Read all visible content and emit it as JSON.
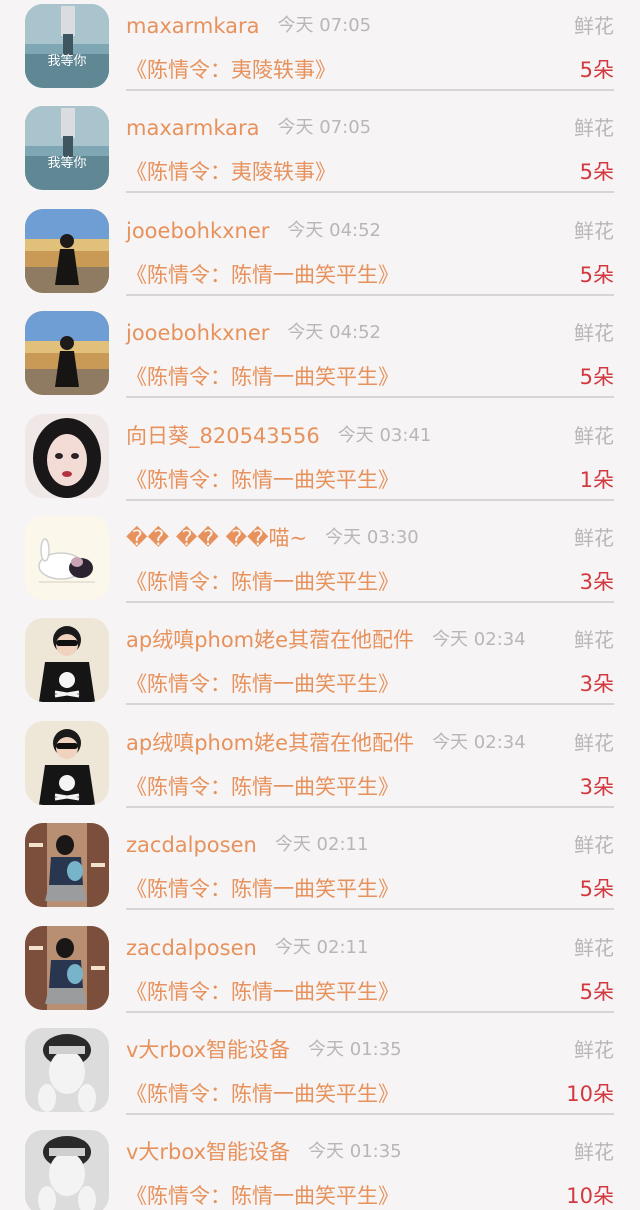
{
  "gift_list": {
    "items": [
      {
        "username": "maxarmkara",
        "time": "今天 07:05",
        "gift": "鲜花",
        "work": "《陈情令：夷陵轶事》",
        "count": "5朵",
        "avatar": "winter-girl-avatar",
        "avatar_text": "我等你"
      },
      {
        "username": "maxarmkara",
        "time": "今天 07:05",
        "gift": "鲜花",
        "work": "《陈情令：夷陵轶事》",
        "count": "5朵",
        "avatar": "winter-girl-avatar",
        "avatar_text": "我等你"
      },
      {
        "username": "jooebohkxner",
        "time": "今天 04:52",
        "gift": "鲜花",
        "work": "《陈情令：陈情一曲笑平生》",
        "count": "5朵",
        "avatar": "field-girl-avatar",
        "avatar_text": ""
      },
      {
        "username": "jooebohkxner",
        "time": "今天 04:52",
        "gift": "鲜花",
        "work": "《陈情令：陈情一曲笑平生》",
        "count": "5朵",
        "avatar": "field-girl-avatar",
        "avatar_text": ""
      },
      {
        "username": "向日葵_820543556",
        "time": "今天 03:41",
        "gift": "鲜花",
        "work": "《陈情令：陈情一曲笑平生》",
        "count": "1朵",
        "avatar": "portrait-girl-avatar",
        "avatar_text": ""
      },
      {
        "username": "�� �� ��喵~",
        "time": "今天 03:30",
        "gift": "鲜花",
        "work": "《陈情令：陈情一曲笑平生》",
        "count": "3朵",
        "avatar": "rabbit-avatar",
        "avatar_text": ""
      },
      {
        "username": "ap绒嗔phom姥e其蓿在他配件",
        "time": "今天 02:34",
        "gift": "鲜花",
        "work": "《陈情令：陈情一曲笑平生》",
        "count": "3朵",
        "avatar": "skull-shirt-avatar",
        "avatar_text": ""
      },
      {
        "username": "ap绒嗔phom姥e其蓿在他配件",
        "time": "今天 02:34",
        "gift": "鲜花",
        "work": "《陈情令：陈情一曲笑平生》",
        "count": "3朵",
        "avatar": "skull-shirt-avatar",
        "avatar_text": ""
      },
      {
        "username": "zacdalposen",
        "time": "今天 02:11",
        "gift": "鲜花",
        "work": "《陈情令：陈情一曲笑平生》",
        "count": "5朵",
        "avatar": "school-girl-avatar",
        "avatar_text": ""
      },
      {
        "username": "zacdalposen",
        "time": "今天 02:11",
        "gift": "鲜花",
        "work": "《陈情令：陈情一曲笑平生》",
        "count": "5朵",
        "avatar": "school-girl-avatar",
        "avatar_text": ""
      },
      {
        "username": "v大rbox智能设备",
        "time": "今天 01:35",
        "gift": "鲜花",
        "work": "《陈情令：陈情一曲笑平生》",
        "count": "10朵",
        "avatar": "bw-boy-avatar",
        "avatar_text": ""
      },
      {
        "username": "v大rbox智能设备",
        "time": "今天 01:35",
        "gift": "鲜花",
        "work": "《陈情令：陈情一曲笑平生》",
        "count": "10朵",
        "avatar": "bw-boy-avatar",
        "avatar_text": ""
      }
    ]
  }
}
